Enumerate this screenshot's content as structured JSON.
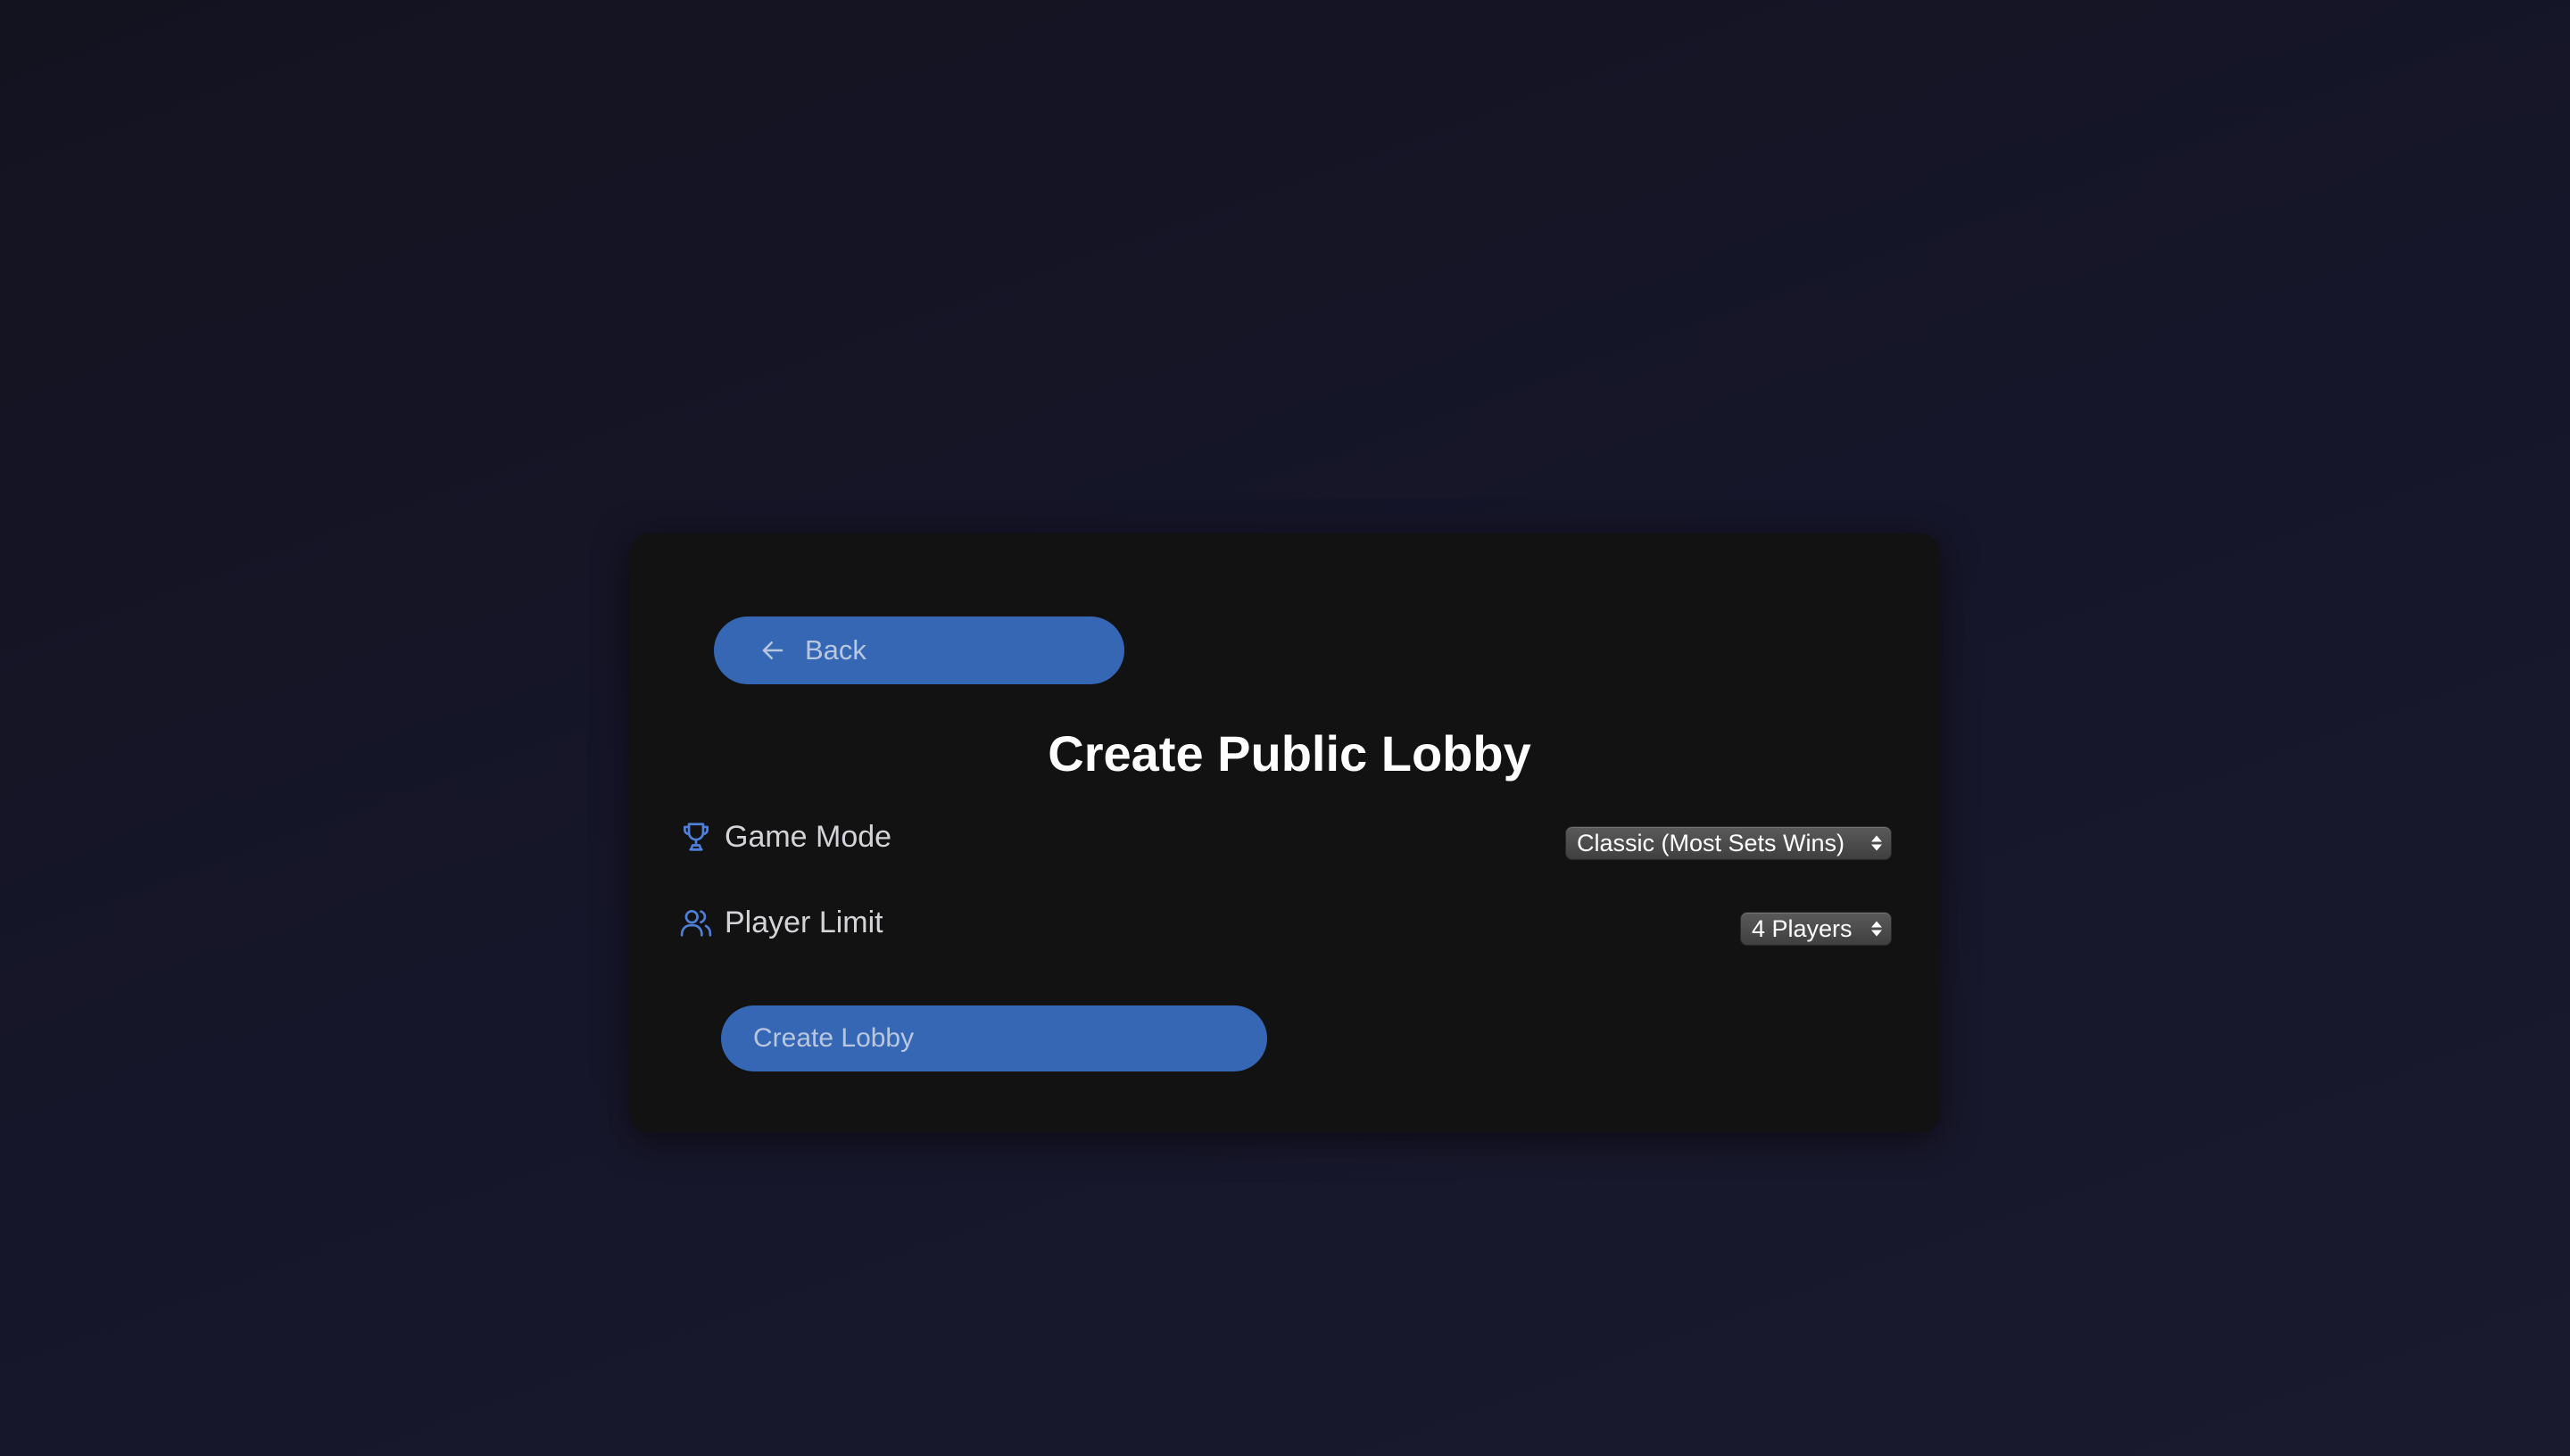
{
  "card": {
    "back_label": "Back",
    "title": "Create Public Lobby",
    "game_mode": {
      "label": "Game Mode",
      "selected": "Classic (Most Sets Wins)"
    },
    "player_limit": {
      "label": "Player Limit",
      "selected": "4 Players"
    },
    "create_label": "Create Lobby"
  },
  "icons": {
    "back": "arrow-left-icon",
    "game_mode": "trophy-icon",
    "player_limit": "users-icon"
  },
  "colors": {
    "accent": "#3567b5",
    "icon_accent": "#4f7fd6",
    "card_bg": "#121212",
    "page_bg": "#15152a"
  }
}
